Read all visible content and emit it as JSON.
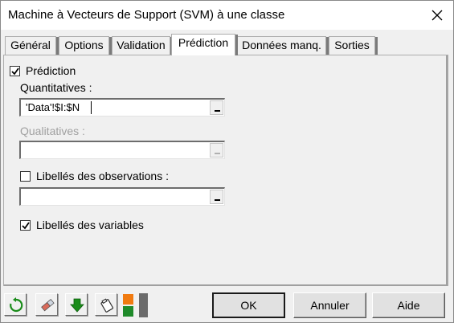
{
  "window": {
    "title": "Machine à Vecteurs de Support (SVM) à une classe"
  },
  "tabs": [
    {
      "label": "Général",
      "active": false
    },
    {
      "label": "Options",
      "active": false
    },
    {
      "label": "Validation",
      "active": false
    },
    {
      "label": "Prédiction",
      "active": true
    },
    {
      "label": "Données manq.",
      "active": false
    },
    {
      "label": "Sorties",
      "active": false
    }
  ],
  "prediction": {
    "prediction_checkbox": {
      "label": "Prédiction",
      "checked": true
    },
    "quantitatives": {
      "label": "Quantitatives :",
      "value": "'Data'!$I:$N"
    },
    "qualitatives": {
      "label": "Qualitatives :",
      "value": "",
      "disabled": true
    },
    "obs_labels_checkbox": {
      "label": "Libellés des observations :",
      "checked": false
    },
    "obs_labels_value": "",
    "var_labels_checkbox": {
      "label": "Libellés des variables",
      "checked": true
    }
  },
  "footer": {
    "icons": [
      "reset-icon",
      "eraser-icon",
      "down-arrow-icon",
      "clipboard-icon",
      "color-squares-icon"
    ],
    "ok_label": "OK",
    "cancel_label": "Annuler",
    "help_label": "Aide"
  },
  "colors": {
    "green_arrow": "#1a8c1a",
    "orange_square": "#f07a10",
    "green_square": "#1f8a2a",
    "gray_bar": "#6b6b6b"
  }
}
